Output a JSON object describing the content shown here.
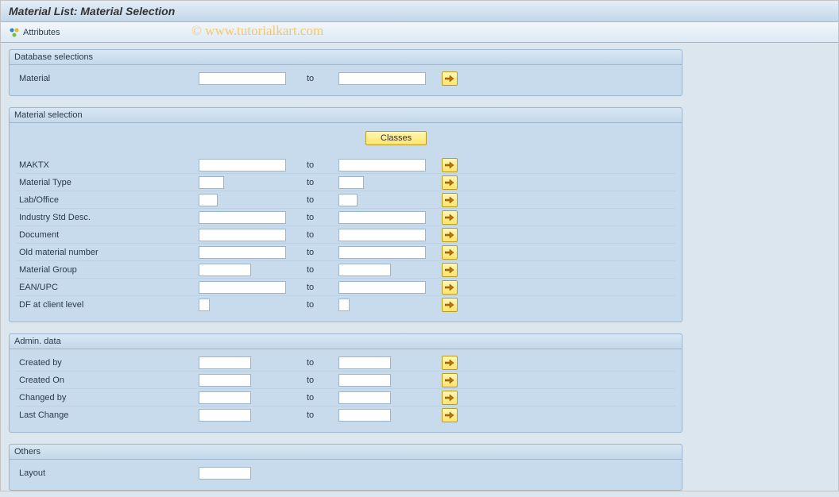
{
  "title": "Material List: Material Selection",
  "watermark": "© www.tutorialkart.com",
  "toolbar": {
    "attributes_label": "Attributes"
  },
  "groups": {
    "database": {
      "header": "Database selections",
      "material_label": "Material",
      "to_label": "to",
      "material_from": "",
      "material_to": ""
    },
    "selection": {
      "header": "Material selection",
      "classes_label": "Classes",
      "to_label": "to",
      "fields": [
        {
          "label": "MAKTX",
          "from_w": 110,
          "to_w": 110,
          "from": "",
          "to": ""
        },
        {
          "label": "Material Type",
          "from_w": 32,
          "to_w": 32,
          "from": "",
          "to": ""
        },
        {
          "label": "Lab/Office",
          "from_w": 24,
          "to_w": 24,
          "from": "",
          "to": ""
        },
        {
          "label": "Industry Std Desc.",
          "from_w": 110,
          "to_w": 110,
          "from": "",
          "to": ""
        },
        {
          "label": "Document",
          "from_w": 110,
          "to_w": 110,
          "from": "",
          "to": ""
        },
        {
          "label": "Old material number",
          "from_w": 110,
          "to_w": 110,
          "from": "",
          "to": ""
        },
        {
          "label": "Material Group",
          "from_w": 66,
          "to_w": 66,
          "from": "",
          "to": ""
        },
        {
          "label": "EAN/UPC",
          "from_w": 110,
          "to_w": 110,
          "from": "",
          "to": ""
        },
        {
          "label": "DF at client level",
          "from_w": 14,
          "to_w": 14,
          "from": "",
          "to": ""
        }
      ]
    },
    "admin": {
      "header": "Admin. data",
      "to_label": "to",
      "fields": [
        {
          "label": "Created by",
          "from_w": 66,
          "to_w": 66,
          "from": "",
          "to": ""
        },
        {
          "label": "Created On",
          "from_w": 66,
          "to_w": 66,
          "from": "",
          "to": ""
        },
        {
          "label": "Changed by",
          "from_w": 66,
          "to_w": 66,
          "from": "",
          "to": ""
        },
        {
          "label": "Last Change",
          "from_w": 66,
          "to_w": 66,
          "from": "",
          "to": ""
        }
      ]
    },
    "others": {
      "header": "Others",
      "layout_label": "Layout",
      "layout_value": ""
    }
  }
}
